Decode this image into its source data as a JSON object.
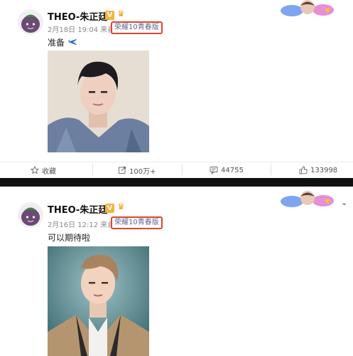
{
  "posts": [
    {
      "name": "THEO-朱正廷",
      "date_time": "2月18日 19:04 来自",
      "source": "荣耀10青春版",
      "text": "准备",
      "text_emoji": "airplane-emoji",
      "actions": {
        "favorite": "收藏",
        "repost": "100万+",
        "comment": "44755",
        "like": "133998"
      }
    },
    {
      "name": "THEO-朱正廷",
      "date_time": "2月16日 12:12 来自",
      "source": "荣耀10青春版",
      "text": "可以期待啦"
    }
  ],
  "badges": {
    "verified": "V"
  },
  "colors": {
    "highlight_border": "#e2432e",
    "verified_badge": "#f6b23a",
    "link": "#5b6a8a"
  }
}
